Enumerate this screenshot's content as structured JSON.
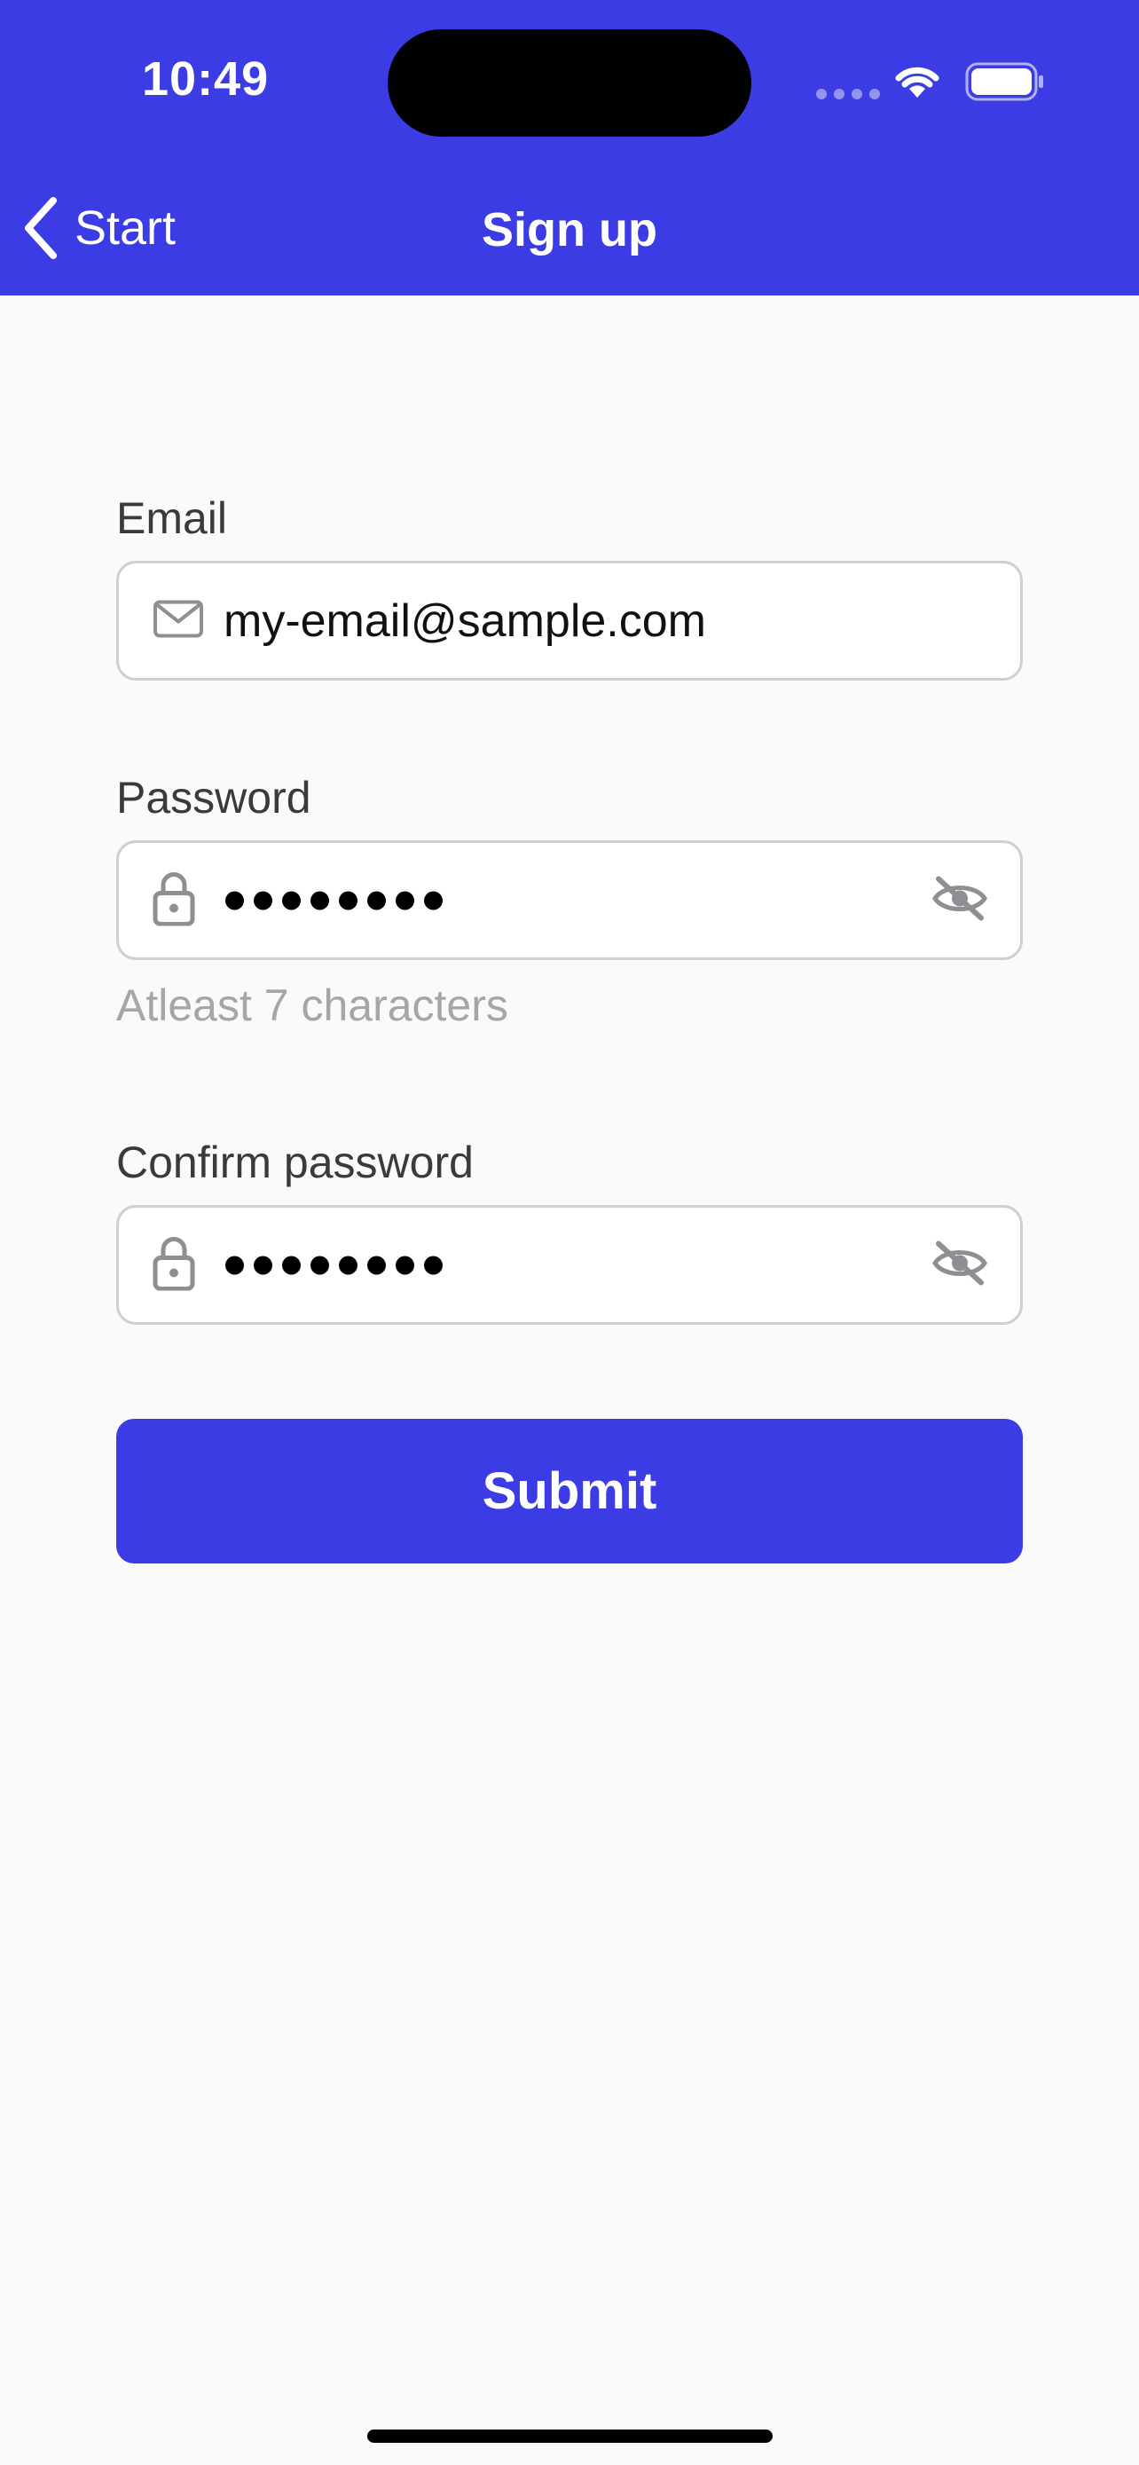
{
  "status_bar": {
    "time": "10:49"
  },
  "nav": {
    "back_label": "Start",
    "title": "Sign up"
  },
  "form": {
    "email": {
      "label": "Email",
      "value": "my-email@sample.com",
      "icon": "envelope-icon"
    },
    "password": {
      "label": "Password",
      "masked_length": 8,
      "hint": "Atleast 7 characters",
      "icon": "lock-icon",
      "toggle_icon": "eye-slash-icon"
    },
    "confirm_password": {
      "label": "Confirm password",
      "masked_length": 8,
      "icon": "lock-icon",
      "toggle_icon": "eye-slash-icon"
    },
    "submit_label": "Submit"
  },
  "colors": {
    "brand": "#3c3ce4",
    "background": "#fafafa",
    "hint": "#a5a5aa"
  }
}
